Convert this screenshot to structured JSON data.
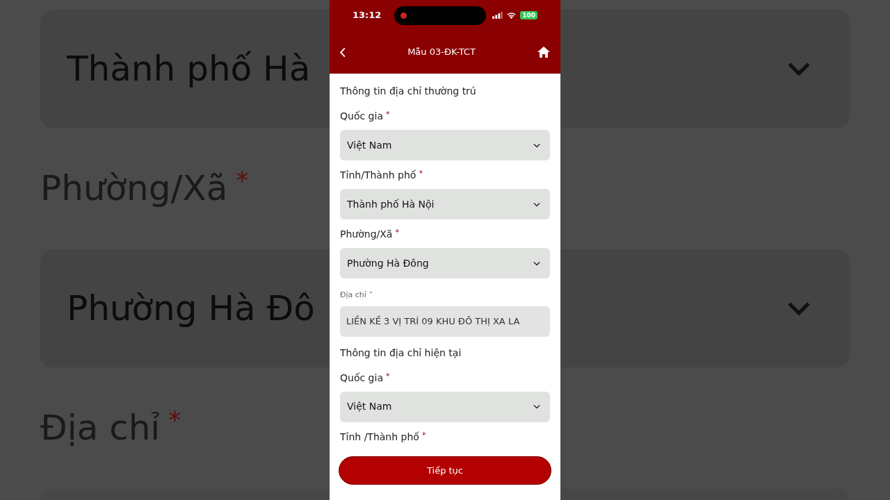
{
  "background": {
    "items": [
      {
        "kind": "select",
        "value": "Thành phố Hà"
      },
      {
        "kind": "label",
        "label": "Phường/Xã",
        "mark": "*"
      },
      {
        "kind": "select",
        "value": "Phường Hà Đô"
      },
      {
        "kind": "label",
        "label": "Địa chỉ",
        "mark": "*"
      },
      {
        "kind": "blank"
      }
    ]
  },
  "status_bar": {
    "time": "13:12",
    "battery": "100",
    "recording": true
  },
  "header": {
    "title": "Mẫu 03-ĐK-TCT"
  },
  "form": [
    {
      "kind": "section",
      "text": "Thông tin địa chỉ thường trú"
    },
    {
      "kind": "label",
      "label": "Quốc gia",
      "mark": "*"
    },
    {
      "kind": "select",
      "value": "Việt Nam"
    },
    {
      "kind": "label",
      "label": "Tỉnh/Thành phố",
      "mark": "*"
    },
    {
      "kind": "select",
      "value": "Thành phố Hà Nội"
    },
    {
      "kind": "label",
      "label": "Phường/Xã",
      "mark": "*"
    },
    {
      "kind": "select",
      "value": "Phường Hà Đông"
    },
    {
      "kind": "input",
      "label": "Địa chỉ",
      "mark": "*",
      "value": "LIỀN KỀ 3 VỊ TRÍ 09 KHU ĐÔ THỊ XA LA"
    },
    {
      "kind": "section",
      "text": "Thông tin địa chỉ hiện tại"
    },
    {
      "kind": "label",
      "label": "Quốc gia",
      "mark": "*"
    },
    {
      "kind": "select",
      "value": "Việt Nam"
    },
    {
      "kind": "label",
      "label": "Tỉnh /Thành phố",
      "mark": "*"
    }
  ],
  "button": {
    "label": "Tiếp tục"
  }
}
